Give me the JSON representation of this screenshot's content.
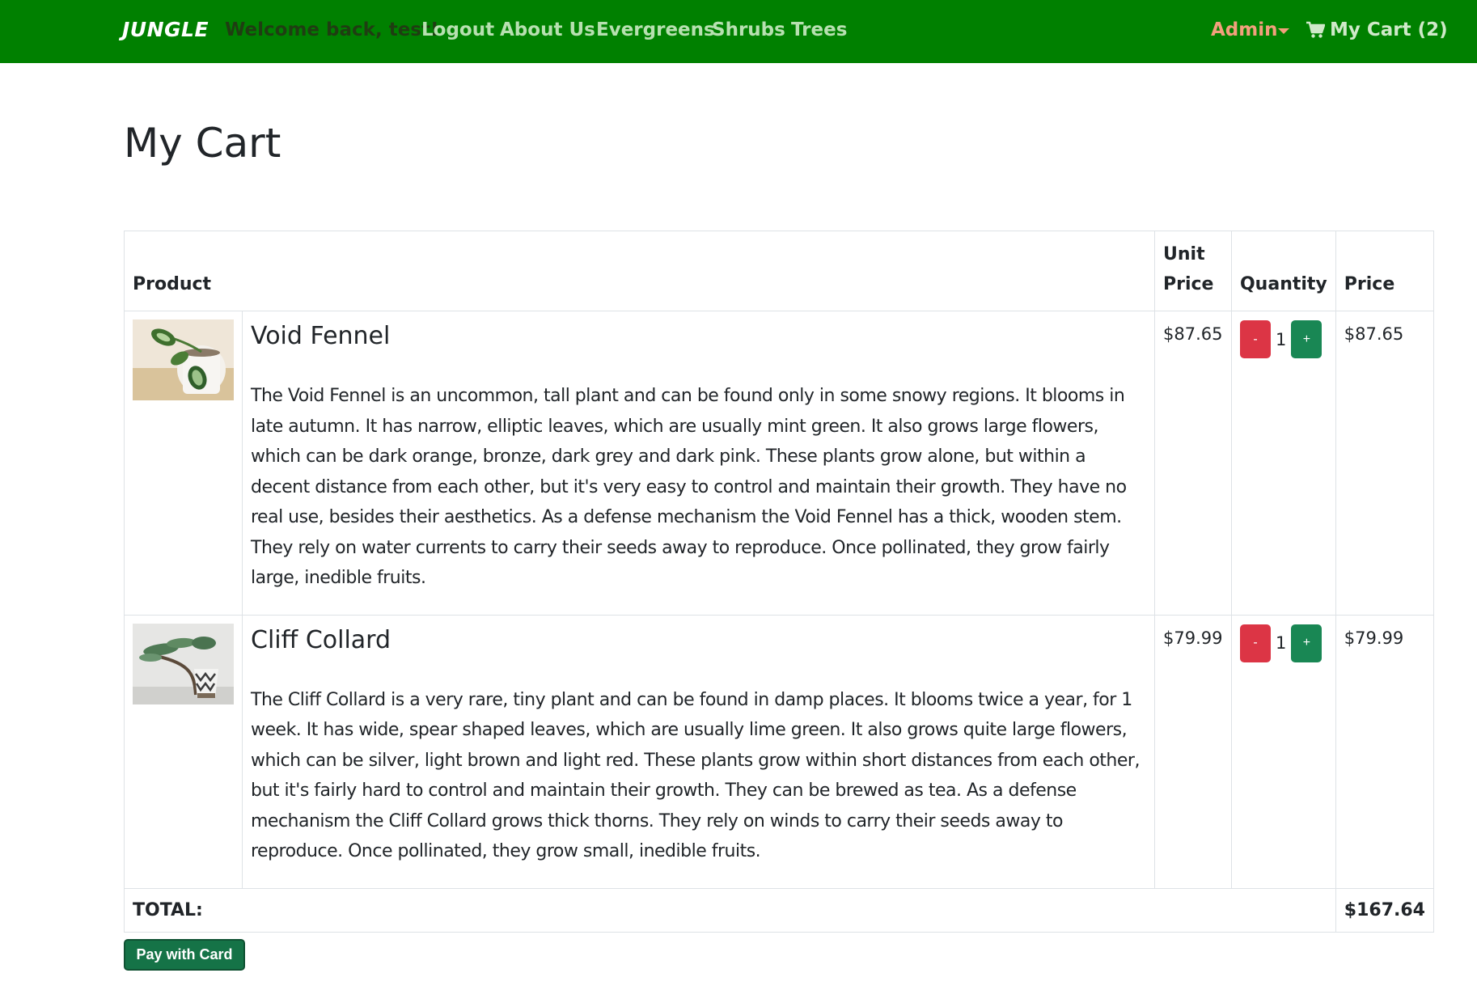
{
  "navbar": {
    "brand": "JUNGLE",
    "welcome": "Welcome back, test!",
    "links": {
      "logout": "Logout",
      "about": "About Us",
      "evergreens": "Evergreens",
      "shrubs": "Shrubs",
      "trees": "Trees"
    },
    "admin": "Admin",
    "cart": "My Cart (2)",
    "background": "#008000"
  },
  "page_title": "My Cart",
  "table": {
    "headers": {
      "product": "Product",
      "unit_price": "Unit Price",
      "quantity": "Quantity",
      "price": "Price"
    },
    "rows": [
      {
        "name": "Void Fennel",
        "image_icon": "potted-plant-photo",
        "description": "The Void Fennel is an uncommon, tall plant and can be found only in some snowy regions. It blooms in late autumn. It has narrow, elliptic leaves, which are usually mint green. It also grows large flowers, which can be dark orange, bronze, dark grey and dark pink. These plants grow alone, but within a decent distance from each other, but it's very easy to control and maintain their growth. They have no real use, besides their aesthetics. As a defense mechanism the Void Fennel has a thick, wooden stem. They rely on water currents to carry their seeds away to reproduce. Once pollinated, they grow fairly large, inedible fruits.",
        "unit_price": "$87.65",
        "minus": "-",
        "quantity": "1",
        "plus": "+",
        "price": "$87.65"
      },
      {
        "name": "Cliff Collard",
        "image_icon": "bonsai-photo",
        "description": "The Cliff Collard is a very rare, tiny plant and can be found in damp places. It blooms twice a year, for 1 week. It has wide, spear shaped leaves, which are usually lime green. It also grows quite large flowers, which can be silver, light brown and light red. These plants grow within short distances from each other, but it's fairly hard to control and maintain their growth. They can be brewed as tea. As a defense mechanism the Cliff Collard grows thick thorns. They rely on winds to carry their seeds away to reproduce. Once pollinated, they grow small, inedible fruits.",
        "unit_price": "$79.99",
        "minus": "-",
        "quantity": "1",
        "plus": "+",
        "price": "$79.99"
      }
    ],
    "total_label": "TOTAL:",
    "total_value": "$167.64"
  },
  "pay_button": "Pay with Card",
  "colors": {
    "minus_button": "#dc3545",
    "plus_button": "#198754",
    "pay_button": "#157347"
  }
}
